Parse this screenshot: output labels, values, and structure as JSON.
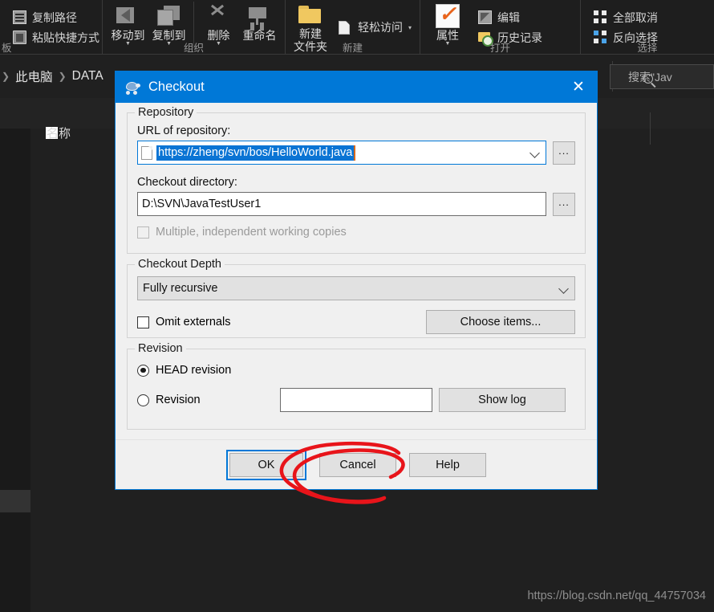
{
  "explorer": {
    "ribbon": {
      "groups": [
        {
          "label": "板",
          "small_items": [
            {
              "label": "复制路径",
              "icon": "copy-path-icon"
            },
            {
              "label": "粘贴快捷方式",
              "icon": "paste-shortcut-icon"
            }
          ],
          "big_items": []
        },
        {
          "label": "组织",
          "small_items": [],
          "big_items": [
            {
              "label": "移动到",
              "icon": "move-to-icon",
              "has_caret": true
            },
            {
              "label": "复制到",
              "icon": "copy-to-icon",
              "has_caret": true
            },
            {
              "label": "删除",
              "icon": "delete-icon",
              "has_caret": true
            },
            {
              "label": "重命名",
              "icon": "rename-icon",
              "has_caret": false
            }
          ]
        },
        {
          "label": "新建",
          "small_items": [
            {
              "label": "轻松访问",
              "icon": "easy-access-icon"
            }
          ],
          "big_items": [
            {
              "label": "新建\n文件夹",
              "icon": "new-folder-icon",
              "has_caret": false
            }
          ]
        },
        {
          "label": "打开",
          "small_items": [
            {
              "label": "编辑",
              "icon": "edit-icon"
            },
            {
              "label": "历史记录",
              "icon": "history-icon"
            }
          ],
          "big_items": [
            {
              "label": "属性",
              "icon": "properties-icon",
              "has_caret": true
            }
          ]
        },
        {
          "label": "选择",
          "small_items": [
            {
              "label": "全部取消",
              "icon": "select-none-icon"
            },
            {
              "label": "反向选择",
              "icon": "invert-selection-icon"
            }
          ],
          "big_items": []
        }
      ]
    },
    "address_bar": {
      "breadcrumb": [
        "此电脑",
        "DATA"
      ],
      "search_value": "搜索\"Jav"
    },
    "list_header": {
      "name_column": "名称"
    },
    "watermark": "https://blog.csdn.net/qq_44757034"
  },
  "dialog": {
    "title": "Checkout",
    "close_label": "✕",
    "repository": {
      "legend": "Repository",
      "url_label": "URL of repository:",
      "url_value": "https://zheng/svn/bos/HelloWorld.java",
      "browse_label": "...",
      "dir_label": "Checkout directory:",
      "dir_value": "D:\\SVN\\JavaTestUser1",
      "dir_browse_label": "...",
      "multiple_label": "Multiple, independent working copies"
    },
    "depth": {
      "legend": "Checkout Depth",
      "selected": "Fully recursive",
      "omit_externals_label": "Omit externals",
      "choose_items_label": "Choose items..."
    },
    "revision": {
      "legend": "Revision",
      "head_label": "HEAD revision",
      "revision_label": "Revision",
      "revision_value": "",
      "show_log_label": "Show log"
    },
    "footer": {
      "ok_label": "OK",
      "cancel_label": "Cancel",
      "help_label": "Help"
    }
  },
  "colors": {
    "accent": "#0078d7",
    "dialog_bg": "#f0f0f0",
    "explorer_bg": "#202020",
    "annotation": "#e8141a"
  }
}
